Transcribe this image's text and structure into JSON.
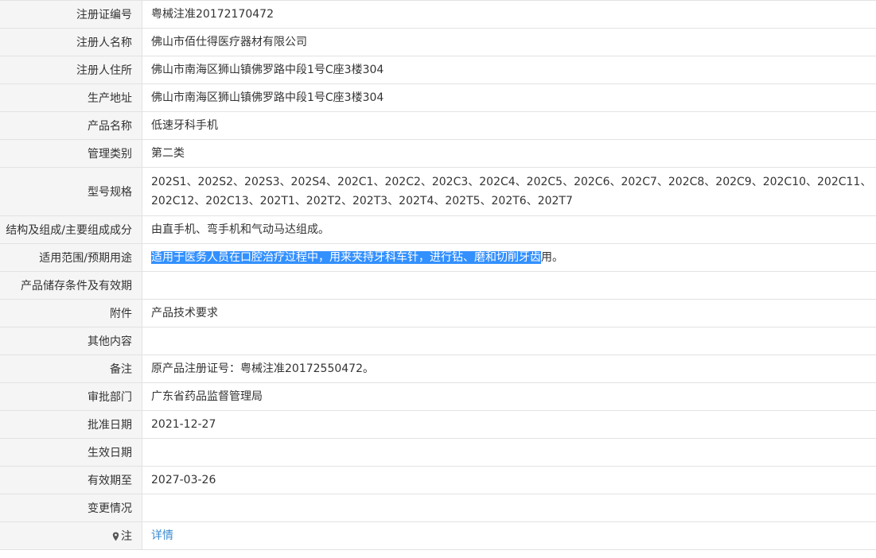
{
  "rows": [
    {
      "label": "注册证编号",
      "value": "粤械注准20172170472"
    },
    {
      "label": "注册人名称",
      "value": "佛山市佰仕得医疗器材有限公司"
    },
    {
      "label": "注册人住所",
      "value": "佛山市南海区狮山镇佛罗路中段1号C座3楼304"
    },
    {
      "label": "生产地址",
      "value": "佛山市南海区狮山镇佛罗路中段1号C座3楼304"
    },
    {
      "label": "产品名称",
      "value": "低速牙科手机"
    },
    {
      "label": "管理类别",
      "value": "第二类"
    },
    {
      "label": "型号规格",
      "value": "202S1、202S2、202S3、202S4、202C1、202C2、202C3、202C4、202C5、202C6、202C7、202C8、202C9、202C10、202C11、202C12、202C13、202T1、202T2、202T3、202T4、202T5、202T6、202T7"
    },
    {
      "label": "结构及组成/主要组成成分",
      "value": "由直手机、弯手机和气动马达组成。"
    },
    {
      "label": "适用范围/预期用途",
      "value_selected": "适用于医务人员在口腔治疗过程中，用来夹持牙科车针，进行钻、磨和切削牙齿",
      "value_rest": "用。"
    },
    {
      "label": "产品储存条件及有效期",
      "value": ""
    },
    {
      "label": "附件",
      "value": "产品技术要求"
    },
    {
      "label": "其他内容",
      "value": ""
    },
    {
      "label": "备注",
      "value": "原产品注册证号：粤械注准20172550472。"
    },
    {
      "label": "审批部门",
      "value": "广东省药品监督管理局"
    },
    {
      "label": "批准日期",
      "value": "2021-12-27"
    },
    {
      "label": "生效日期",
      "value": ""
    },
    {
      "label": "有效期至",
      "value": "2027-03-26"
    },
    {
      "label": "变更情况",
      "value": ""
    },
    {
      "label": "注",
      "value": "详情",
      "icon": "pin-icon"
    }
  ]
}
